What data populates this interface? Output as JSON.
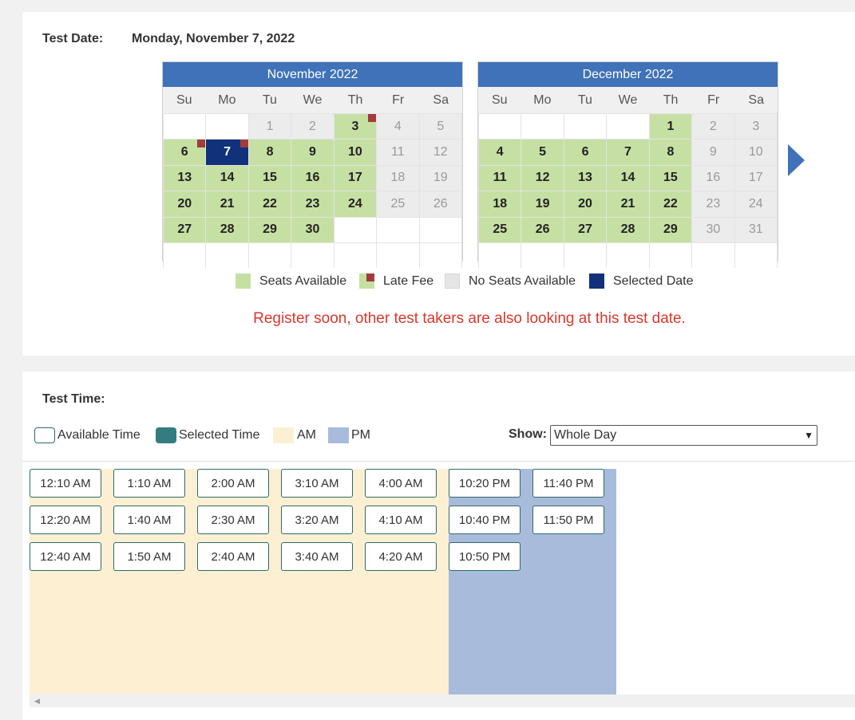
{
  "test_date": {
    "label": "Test Date:",
    "value": "Monday, November 7, 2022"
  },
  "calendars": [
    {
      "title": "November 2022",
      "dow": [
        "Su",
        "Mo",
        "Tu",
        "We",
        "Th",
        "Fr",
        "Sa"
      ],
      "cells": [
        {
          "t": "",
          "s": "empty"
        },
        {
          "t": "",
          "s": "empty"
        },
        {
          "t": "1",
          "s": "noseat"
        },
        {
          "t": "2",
          "s": "noseat"
        },
        {
          "t": "3",
          "s": "avail",
          "late": true
        },
        {
          "t": "4",
          "s": "noseat"
        },
        {
          "t": "5",
          "s": "noseat"
        },
        {
          "t": "6",
          "s": "avail",
          "late": true
        },
        {
          "t": "7",
          "s": "selected",
          "late": true
        },
        {
          "t": "8",
          "s": "avail"
        },
        {
          "t": "9",
          "s": "avail"
        },
        {
          "t": "10",
          "s": "avail"
        },
        {
          "t": "11",
          "s": "noseat"
        },
        {
          "t": "12",
          "s": "noseat"
        },
        {
          "t": "13",
          "s": "avail"
        },
        {
          "t": "14",
          "s": "avail"
        },
        {
          "t": "15",
          "s": "avail"
        },
        {
          "t": "16",
          "s": "avail"
        },
        {
          "t": "17",
          "s": "avail"
        },
        {
          "t": "18",
          "s": "noseat"
        },
        {
          "t": "19",
          "s": "noseat"
        },
        {
          "t": "20",
          "s": "avail"
        },
        {
          "t": "21",
          "s": "avail"
        },
        {
          "t": "22",
          "s": "avail"
        },
        {
          "t": "23",
          "s": "avail"
        },
        {
          "t": "24",
          "s": "avail"
        },
        {
          "t": "25",
          "s": "noseat"
        },
        {
          "t": "26",
          "s": "noseat"
        },
        {
          "t": "27",
          "s": "avail"
        },
        {
          "t": "28",
          "s": "avail"
        },
        {
          "t": "29",
          "s": "avail"
        },
        {
          "t": "30",
          "s": "avail"
        },
        {
          "t": "",
          "s": "empty"
        },
        {
          "t": "",
          "s": "empty"
        },
        {
          "t": "",
          "s": "empty"
        },
        {
          "t": "",
          "s": "empty"
        },
        {
          "t": "",
          "s": "empty"
        },
        {
          "t": "",
          "s": "empty"
        },
        {
          "t": "",
          "s": "empty"
        },
        {
          "t": "",
          "s": "empty"
        },
        {
          "t": "",
          "s": "empty"
        },
        {
          "t": "",
          "s": "empty"
        }
      ]
    },
    {
      "title": "December 2022",
      "dow": [
        "Su",
        "Mo",
        "Tu",
        "We",
        "Th",
        "Fr",
        "Sa"
      ],
      "cells": [
        {
          "t": "",
          "s": "empty"
        },
        {
          "t": "",
          "s": "empty"
        },
        {
          "t": "",
          "s": "empty"
        },
        {
          "t": "",
          "s": "empty"
        },
        {
          "t": "1",
          "s": "avail"
        },
        {
          "t": "2",
          "s": "noseat"
        },
        {
          "t": "3",
          "s": "noseat"
        },
        {
          "t": "4",
          "s": "avail"
        },
        {
          "t": "5",
          "s": "avail"
        },
        {
          "t": "6",
          "s": "avail"
        },
        {
          "t": "7",
          "s": "avail"
        },
        {
          "t": "8",
          "s": "avail"
        },
        {
          "t": "9",
          "s": "noseat"
        },
        {
          "t": "10",
          "s": "noseat"
        },
        {
          "t": "11",
          "s": "avail"
        },
        {
          "t": "12",
          "s": "avail"
        },
        {
          "t": "13",
          "s": "avail"
        },
        {
          "t": "14",
          "s": "avail"
        },
        {
          "t": "15",
          "s": "avail"
        },
        {
          "t": "16",
          "s": "noseat"
        },
        {
          "t": "17",
          "s": "noseat"
        },
        {
          "t": "18",
          "s": "avail"
        },
        {
          "t": "19",
          "s": "avail"
        },
        {
          "t": "20",
          "s": "avail"
        },
        {
          "t": "21",
          "s": "avail"
        },
        {
          "t": "22",
          "s": "avail"
        },
        {
          "t": "23",
          "s": "noseat"
        },
        {
          "t": "24",
          "s": "noseat"
        },
        {
          "t": "25",
          "s": "avail"
        },
        {
          "t": "26",
          "s": "avail"
        },
        {
          "t": "27",
          "s": "avail"
        },
        {
          "t": "28",
          "s": "avail"
        },
        {
          "t": "29",
          "s": "avail"
        },
        {
          "t": "30",
          "s": "noseat"
        },
        {
          "t": "31",
          "s": "noseat"
        },
        {
          "t": "",
          "s": "empty"
        },
        {
          "t": "",
          "s": "empty"
        },
        {
          "t": "",
          "s": "empty"
        },
        {
          "t": "",
          "s": "empty"
        },
        {
          "t": "",
          "s": "empty"
        },
        {
          "t": "",
          "s": "empty"
        },
        {
          "t": "",
          "s": "empty"
        }
      ]
    }
  ],
  "date_legend": {
    "seats_available": "Seats Available",
    "late_fee": "Late Fee",
    "no_seats": "No Seats Available",
    "selected_date": "Selected Date"
  },
  "notice": "Register soon, other test takers are also looking at this test date.",
  "test_time": {
    "label": "Test Time:"
  },
  "time_legend": {
    "available": "Available Time",
    "selected": "Selected Time",
    "am": "AM",
    "pm": "PM"
  },
  "show": {
    "label": "Show:",
    "value": "Whole Day"
  },
  "slots": [
    [
      "12:10 AM",
      "12:20 AM",
      "12:40 AM"
    ],
    [
      "1:10 AM",
      "1:40 AM",
      "1:50 AM"
    ],
    [
      "2:00 AM",
      "2:30 AM",
      "2:40 AM"
    ],
    [
      "3:10 AM",
      "3:20 AM",
      "3:40 AM"
    ],
    [
      "4:00 AM",
      "4:10 AM",
      "4:20 AM"
    ],
    [
      "10:20 PM",
      "10:40 PM",
      "10:50 PM"
    ],
    [
      "11:40 PM",
      "11:50 PM"
    ]
  ],
  "colors": {
    "header_blue": "#3f72b8",
    "available_green": "#c6e0a3",
    "selected_navy": "#12317b",
    "late_fee_red": "#a33b3b",
    "notice_red": "#d9382c",
    "am_band": "#fdf0d2",
    "pm_band": "#a8bbdb",
    "selected_time_teal": "#337d80"
  },
  "icons": {
    "next_month": "triangle-right-icon",
    "dropdown": "chevron-down-icon",
    "scroll_left": "triangle-left-icon"
  }
}
